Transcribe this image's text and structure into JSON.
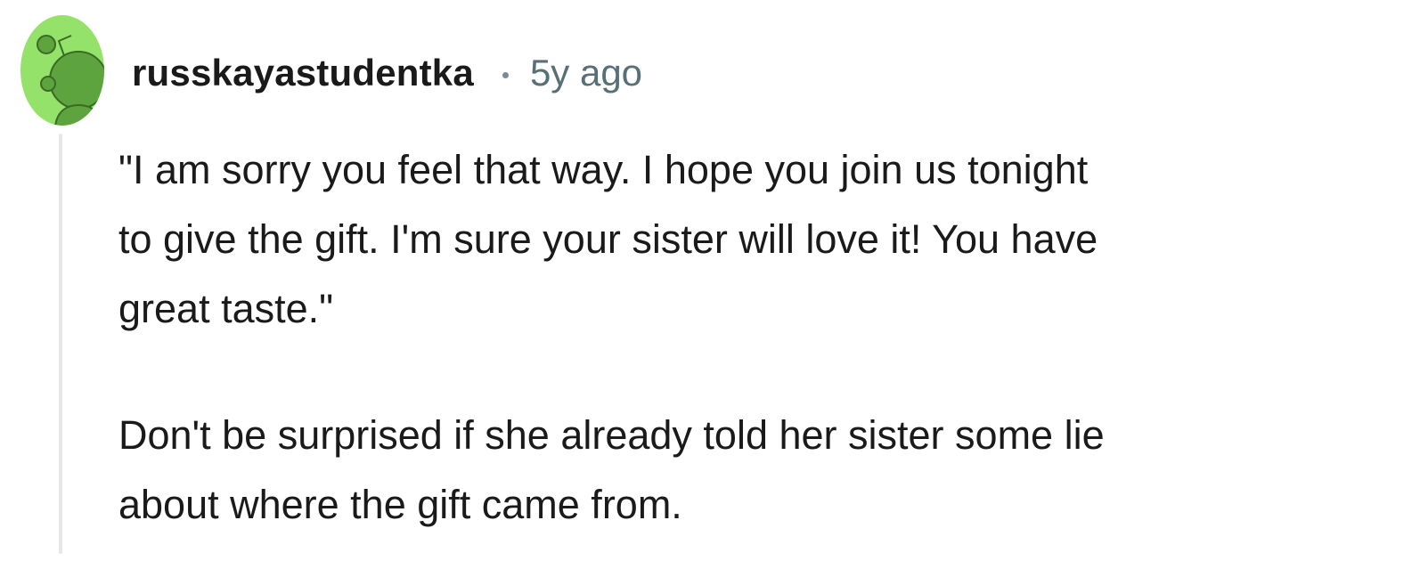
{
  "comment": {
    "author": "russkayastudentka",
    "timestamp": "5y ago",
    "avatar_icon": "snoo-avatar-icon",
    "avatar_color": "#94e26a",
    "paragraphs": [
      {
        "lines": [
          "\"I am sorry you feel that way. I hope you join us tonight",
          "to give the gift. I'm sure your sister will love it! You have",
          "great taste.\""
        ]
      },
      {
        "lines": [
          "Don't be surprised if she already told her sister some lie",
          "about where the gift came from."
        ]
      }
    ]
  }
}
